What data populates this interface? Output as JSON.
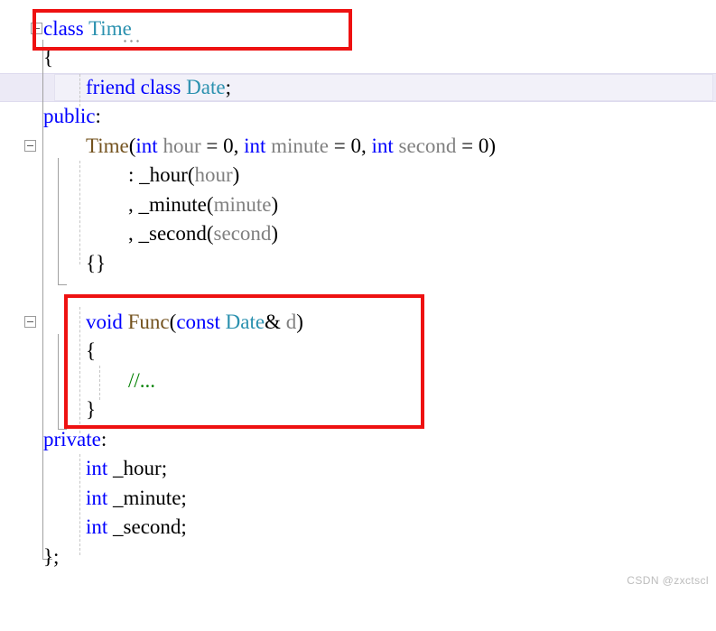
{
  "editor": {
    "language": "C++",
    "background_color": "#ffffff",
    "font_size_px": 23,
    "colors": {
      "keyword": "#0000ff",
      "user_type": "#2b91af",
      "function": "#74531f",
      "parameter": "#808080",
      "comment": "#008000",
      "punctuation": "#000000",
      "highlight_band": "#eceaf6",
      "annotation_red": "#ee1111",
      "gutter_guide": "#a0a0a0",
      "watermark": "#bcbcbc"
    },
    "lines": [
      {
        "id": "line-class-decl",
        "indent": 0,
        "tokens": [
          {
            "t": "class",
            "c": "kw"
          },
          {
            "t": " ",
            "c": "plain"
          },
          {
            "t": "Time",
            "c": "type"
          }
        ]
      },
      {
        "id": "line-class-open-brace",
        "indent": 0,
        "tokens": [
          {
            "t": "{",
            "c": "punct"
          }
        ]
      },
      {
        "id": "line-friend-decl",
        "indent": 2,
        "tokens": [
          {
            "t": "friend",
            "c": "kw"
          },
          {
            "t": " ",
            "c": "plain"
          },
          {
            "t": "class",
            "c": "kw"
          },
          {
            "t": " ",
            "c": "plain"
          },
          {
            "t": "Date",
            "c": "type"
          },
          {
            "t": ";",
            "c": "punct"
          }
        ]
      },
      {
        "id": "line-public-label",
        "indent": 0,
        "tokens": [
          {
            "t": "public",
            "c": "kw"
          },
          {
            "t": ":",
            "c": "punct"
          }
        ]
      },
      {
        "id": "line-ctor-signature",
        "indent": 2,
        "tokens": [
          {
            "t": "Time",
            "c": "func"
          },
          {
            "t": "(",
            "c": "punct"
          },
          {
            "t": "int",
            "c": "kw"
          },
          {
            "t": " ",
            "c": "plain"
          },
          {
            "t": "hour",
            "c": "ident"
          },
          {
            "t": " = ",
            "c": "punct"
          },
          {
            "t": "0",
            "c": "num"
          },
          {
            "t": ", ",
            "c": "punct"
          },
          {
            "t": "int",
            "c": "kw"
          },
          {
            "t": " ",
            "c": "plain"
          },
          {
            "t": "minute",
            "c": "ident"
          },
          {
            "t": " = ",
            "c": "punct"
          },
          {
            "t": "0",
            "c": "num"
          },
          {
            "t": ", ",
            "c": "punct"
          },
          {
            "t": "int",
            "c": "kw"
          },
          {
            "t": " ",
            "c": "plain"
          },
          {
            "t": "second",
            "c": "ident"
          },
          {
            "t": " = ",
            "c": "punct"
          },
          {
            "t": "0",
            "c": "num"
          },
          {
            "t": ")",
            "c": "punct"
          }
        ]
      },
      {
        "id": "line-init-hour",
        "indent": 4,
        "tokens": [
          {
            "t": ": _hour",
            "c": "plain"
          },
          {
            "t": "(",
            "c": "punct"
          },
          {
            "t": "hour",
            "c": "ident"
          },
          {
            "t": ")",
            "c": "punct"
          }
        ]
      },
      {
        "id": "line-init-minute",
        "indent": 4,
        "tokens": [
          {
            "t": ", _minute",
            "c": "plain"
          },
          {
            "t": "(",
            "c": "punct"
          },
          {
            "t": "minute",
            "c": "ident"
          },
          {
            "t": ")",
            "c": "punct"
          }
        ]
      },
      {
        "id": "line-init-second",
        "indent": 4,
        "tokens": [
          {
            "t": ", _second",
            "c": "plain"
          },
          {
            "t": "(",
            "c": "punct"
          },
          {
            "t": "second",
            "c": "ident"
          },
          {
            "t": ")",
            "c": "punct"
          }
        ]
      },
      {
        "id": "line-ctor-body",
        "indent": 2,
        "tokens": [
          {
            "t": "{}",
            "c": "punct"
          }
        ]
      },
      {
        "id": "line-blank-1",
        "indent": 0,
        "tokens": []
      },
      {
        "id": "line-func-signature",
        "indent": 2,
        "tokens": [
          {
            "t": "void",
            "c": "kw"
          },
          {
            "t": " ",
            "c": "plain"
          },
          {
            "t": "Func",
            "c": "func"
          },
          {
            "t": "(",
            "c": "punct"
          },
          {
            "t": "const",
            "c": "kw"
          },
          {
            "t": " ",
            "c": "plain"
          },
          {
            "t": "Date",
            "c": "type"
          },
          {
            "t": "&",
            "c": "punct"
          },
          {
            "t": " ",
            "c": "plain"
          },
          {
            "t": "d",
            "c": "ident"
          },
          {
            "t": ")",
            "c": "punct"
          }
        ]
      },
      {
        "id": "line-func-open-brace",
        "indent": 2,
        "tokens": [
          {
            "t": "{",
            "c": "punct"
          }
        ]
      },
      {
        "id": "line-func-comment",
        "indent": 4,
        "tokens": [
          {
            "t": "//...",
            "c": "cmt"
          }
        ]
      },
      {
        "id": "line-func-close-brace",
        "indent": 2,
        "tokens": [
          {
            "t": "}",
            "c": "punct"
          }
        ]
      },
      {
        "id": "line-private-label",
        "indent": 0,
        "tokens": [
          {
            "t": "private",
            "c": "kw"
          },
          {
            "t": ":",
            "c": "punct"
          }
        ]
      },
      {
        "id": "line-member-hour",
        "indent": 2,
        "tokens": [
          {
            "t": "int",
            "c": "kw"
          },
          {
            "t": " _hour",
            "c": "plain"
          },
          {
            "t": ";",
            "c": "punct"
          }
        ]
      },
      {
        "id": "line-member-minute",
        "indent": 2,
        "tokens": [
          {
            "t": "int",
            "c": "kw"
          },
          {
            "t": " _minute",
            "c": "plain"
          },
          {
            "t": ";",
            "c": "punct"
          }
        ]
      },
      {
        "id": "line-member-second",
        "indent": 2,
        "tokens": [
          {
            "t": "int",
            "c": "kw"
          },
          {
            "t": " _second",
            "c": "plain"
          },
          {
            "t": ";",
            "c": "punct"
          }
        ]
      },
      {
        "id": "line-class-close",
        "indent": 0,
        "tokens": [
          {
            "t": "};",
            "c": "punct"
          }
        ]
      }
    ],
    "fold_markers": [
      {
        "id": "fold-class",
        "for_line": "line-class-decl",
        "state": "expanded",
        "glyph": "minus"
      },
      {
        "id": "fold-ctor",
        "for_line": "line-ctor-signature",
        "state": "expanded",
        "glyph": "minus"
      },
      {
        "id": "fold-func",
        "for_line": "line-func-signature",
        "state": "expanded",
        "glyph": "minus"
      }
    ],
    "highlighted_line": "line-friend-decl"
  },
  "annotations": [
    {
      "id": "redbox-class-header",
      "target": "line-class-decl",
      "color": "#ee1111"
    },
    {
      "id": "redbox-func-block",
      "target": "line-func-signature",
      "color": "#ee1111"
    }
  ],
  "watermark": {
    "text": "CSDN @zxctscl"
  }
}
